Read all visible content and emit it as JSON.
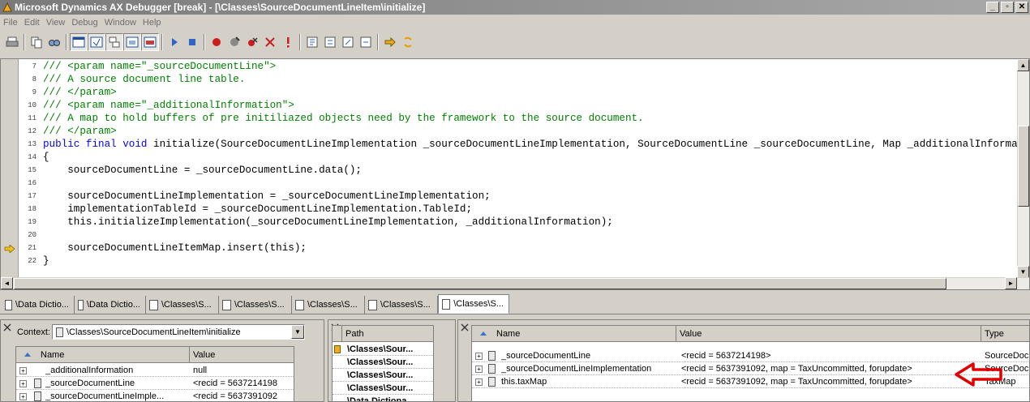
{
  "window": {
    "title": "Microsoft Dynamics AX Debugger [break] - [\\Classes\\SourceDocumentLineItem\\initialize]",
    "controls": [
      "_",
      "▫",
      "✕"
    ]
  },
  "menu": [
    "File",
    "Edit",
    "View",
    "Debug",
    "Window",
    "Help"
  ],
  "editor": {
    "lines": [
      {
        "no": "7",
        "text": "/// <param name=\"_sourceDocumentLine\">",
        "kind": "comment"
      },
      {
        "no": "8",
        "text": "/// A source document line table.",
        "kind": "comment"
      },
      {
        "no": "9",
        "text": "/// </param>",
        "kind": "comment"
      },
      {
        "no": "10",
        "text": "/// <param name=\"_additionalInformation\">",
        "kind": "comment"
      },
      {
        "no": "11",
        "text": "/// A map to hold buffers of pre initiliazed objects need by the framework to the source document.",
        "kind": "comment"
      },
      {
        "no": "12",
        "text": "/// </param>",
        "kind": "comment"
      },
      {
        "no": "13",
        "kw": "public final void",
        "text": " initialize(SourceDocumentLineImplementation _sourceDocumentLineImplementation, SourceDocumentLine _sourceDocumentLine, Map _additionalInformation)",
        "kind": "signature"
      },
      {
        "no": "14",
        "text": "{",
        "kind": "code"
      },
      {
        "no": "15",
        "text": "    sourceDocumentLine = _sourceDocumentLine.data();",
        "kind": "code"
      },
      {
        "no": "16",
        "text": "",
        "kind": "code"
      },
      {
        "no": "17",
        "text": "    sourceDocumentLineImplementation = _sourceDocumentLineImplementation;",
        "kind": "code"
      },
      {
        "no": "18",
        "text": "    implementationTableId = _sourceDocumentLineImplementation.TableId;",
        "kind": "code"
      },
      {
        "no": "19",
        "text": "    this.initializeImplementation(_sourceDocumentLineImplementation, _additionalInformation);",
        "kind": "code"
      },
      {
        "no": "20",
        "text": "",
        "kind": "code"
      },
      {
        "no": "21",
        "text": "    sourceDocumentLineItemMap.insert(this);",
        "kind": "code"
      },
      {
        "no": "22",
        "text": "}",
        "kind": "code"
      }
    ],
    "current_line": "21"
  },
  "tabs": [
    {
      "label": "\\Data Dictio...",
      "active": false
    },
    {
      "label": "\\Data Dictio...",
      "active": false
    },
    {
      "label": "\\Classes\\S...",
      "active": false
    },
    {
      "label": "\\Classes\\S...",
      "active": false
    },
    {
      "label": "\\Classes\\S...",
      "active": false
    },
    {
      "label": "\\Classes\\S...",
      "active": false
    },
    {
      "label": "\\Classes\\S...",
      "active": true
    }
  ],
  "variables_panel": {
    "context_label": "Context:",
    "context_value": "\\Classes\\SourceDocumentLineItem\\initialize",
    "columns": [
      "Name",
      "Value"
    ],
    "rows": [
      {
        "name": "_additionalInformation",
        "value": "null",
        "icon": false
      },
      {
        "name": "_sourceDocumentLine",
        "value": "<recid = 5637214198",
        "icon": true
      },
      {
        "name": "_sourceDocumentLineImple...",
        "value": "<recid = 5637391092",
        "icon": true
      }
    ]
  },
  "callstack_panel": {
    "column": "Path",
    "rows": [
      "\\Classes\\Sour...",
      "\\Classes\\Sour...",
      "\\Classes\\Sour...",
      "\\Classes\\Sour...",
      "\\Data Dictiona..."
    ]
  },
  "watch_panel": {
    "columns": [
      "Name",
      "Value",
      "Type"
    ],
    "rows": [
      {
        "name": "_sourceDocumentLine",
        "value": "<recid = 5637214198>",
        "type": "SourceDoc"
      },
      {
        "name": "_sourceDocumentLineImplementation",
        "value": "<recid = 5637391092, map = TaxUncommitted, forupdate>",
        "type": "SourceDoc"
      },
      {
        "name": "this.taxMap",
        "value": "<recid = 5637391092, map = TaxUncommitted, forupdate>",
        "type": "TaxMap"
      }
    ],
    "highlight_color": "#e00000"
  }
}
